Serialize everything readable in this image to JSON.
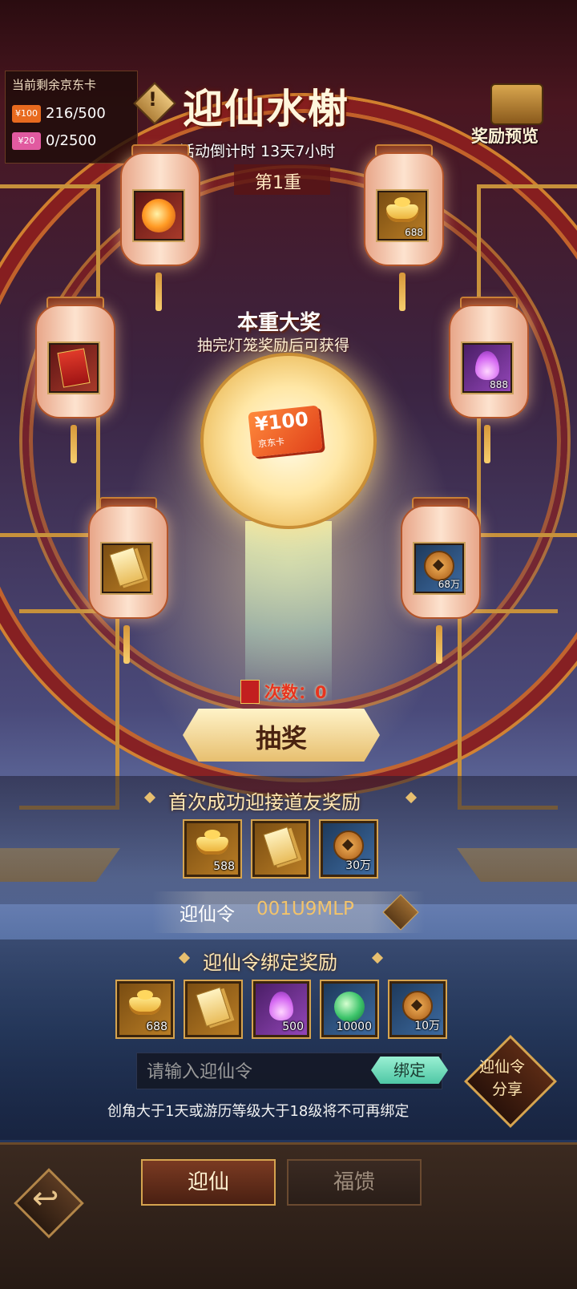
{
  "header": {
    "title": "迎仙水榭",
    "countdown": "活动倒计时 13天7小时",
    "stage": "第1重",
    "preview_label": "奖励预览",
    "info_icon": "exclamation-icon"
  },
  "remaining_panel": {
    "header": "当前剩余京东卡",
    "rows": [
      {
        "tag": "¥100",
        "value": "216/500",
        "color": "#e86a1f"
      },
      {
        "tag": "¥20",
        "value": "0/2500",
        "color": "#e15aa0"
      }
    ]
  },
  "grand_prize": {
    "title": "本重大奖",
    "subtitle": "抽完灯笼奖励后可获得",
    "card_amount": "¥100",
    "card_label": "京东卡"
  },
  "lanterns": [
    {
      "icon": "fire-orb-icon",
      "count": ""
    },
    {
      "icon": "gold-ingot-icon",
      "count": "688"
    },
    {
      "icon": "red-envelope-icon",
      "count": ""
    },
    {
      "icon": "purple-flame-icon",
      "count": "888"
    },
    {
      "icon": "golden-ticket-icon",
      "count": ""
    },
    {
      "icon": "copper-coin-icon",
      "count": "68万"
    }
  ],
  "draw": {
    "count_text": "次数：0",
    "button_label": "抽奖"
  },
  "first_reward": {
    "title": "首次成功迎接道友奖励",
    "items": [
      {
        "icon": "gold-ingot-icon",
        "count": "588"
      },
      {
        "icon": "golden-ticket-icon",
        "count": ""
      },
      {
        "icon": "copper-coin-icon",
        "count": "30万"
      }
    ]
  },
  "code": {
    "label": "迎仙令",
    "value": "001U9MLP",
    "copy_icon": "copy-icon"
  },
  "bind_reward": {
    "title": "迎仙令绑定奖励",
    "items": [
      {
        "icon": "gold-ingot-icon",
        "count": "688"
      },
      {
        "icon": "golden-ticket-icon",
        "count": ""
      },
      {
        "icon": "purple-flame-icon",
        "count": "500"
      },
      {
        "icon": "green-orb-icon",
        "count": "10000"
      },
      {
        "icon": "copper-coin-icon",
        "count": "10万"
      }
    ],
    "input_placeholder": "请输入迎仙令",
    "bind_button": "绑定",
    "note": "创角大于1天或游历等级大于18级将不可再绑定"
  },
  "share_button": {
    "line1": "迎仙令",
    "line2": "分享"
  },
  "bottom_nav": {
    "back_icon": "back-arrow-icon",
    "tabs": [
      {
        "label": "迎仙",
        "active": true
      },
      {
        "label": "福馈",
        "active": false
      }
    ]
  },
  "colors": {
    "accent_gold": "#e7bf6f",
    "lantern": "#fde3cf",
    "deep_red": "#8a1f1f"
  }
}
